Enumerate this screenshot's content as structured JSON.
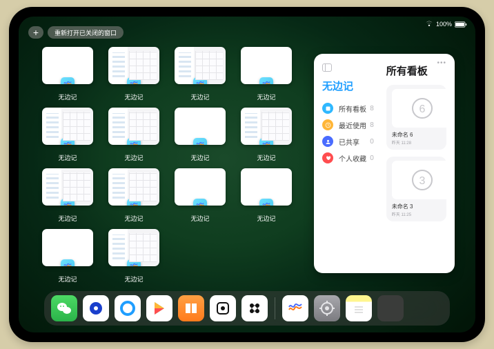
{
  "status": {
    "wifi": "wifi-icon",
    "battery": "100%"
  },
  "top": {
    "plus_label": "+",
    "reopen_label": "重新打开已关闭的窗口"
  },
  "windows": [
    {
      "label": "无边记",
      "kind": "blank"
    },
    {
      "label": "无边记",
      "kind": "split"
    },
    {
      "label": "无边记",
      "kind": "split"
    },
    {
      "label": "无边记",
      "kind": "blank"
    },
    {
      "label": "无边记",
      "kind": "split"
    },
    {
      "label": "无边记",
      "kind": "split"
    },
    {
      "label": "无边记",
      "kind": "blank"
    },
    {
      "label": "无边记",
      "kind": "split"
    },
    {
      "label": "无边记",
      "kind": "split"
    },
    {
      "label": "无边记",
      "kind": "split"
    },
    {
      "label": "无边记",
      "kind": "blank"
    },
    {
      "label": "无边记",
      "kind": "blank"
    },
    {
      "label": "无边记",
      "kind": "blank"
    },
    {
      "label": "无边记",
      "kind": "split"
    }
  ],
  "panel": {
    "left_title": "无边记",
    "right_title": "所有看板",
    "items": [
      {
        "icon_color": "#2fb8ff",
        "label": "所有看板",
        "count": 8
      },
      {
        "icon_color": "#ffb638",
        "label": "最近使用",
        "count": 8
      },
      {
        "icon_color": "#4a6cff",
        "label": "已共享",
        "count": 0
      },
      {
        "icon_color": "#ff4d4f",
        "label": "个人收藏",
        "count": 0
      }
    ],
    "boards": [
      {
        "name": "未命名 6",
        "time": "昨天 11:28",
        "digit": "6"
      },
      {
        "name": "未命名 3",
        "time": "昨天 11:25",
        "digit": "3"
      }
    ]
  },
  "dock": [
    {
      "name": "wechat",
      "class": "ic-wechat"
    },
    {
      "name": "app-blue1",
      "class": "ic-app1"
    },
    {
      "name": "app-blue2",
      "class": "ic-app2"
    },
    {
      "name": "play",
      "class": "ic-play"
    },
    {
      "name": "books",
      "class": "ic-books"
    },
    {
      "name": "dice",
      "class": "ic-dice"
    },
    {
      "name": "music",
      "class": "ic-music"
    },
    {
      "name": "separator"
    },
    {
      "name": "freeform",
      "class": "ic-free"
    },
    {
      "name": "settings",
      "class": "ic-sett"
    },
    {
      "name": "notes",
      "class": "ic-notes"
    },
    {
      "name": "app-library",
      "class": "ic-stack"
    }
  ]
}
